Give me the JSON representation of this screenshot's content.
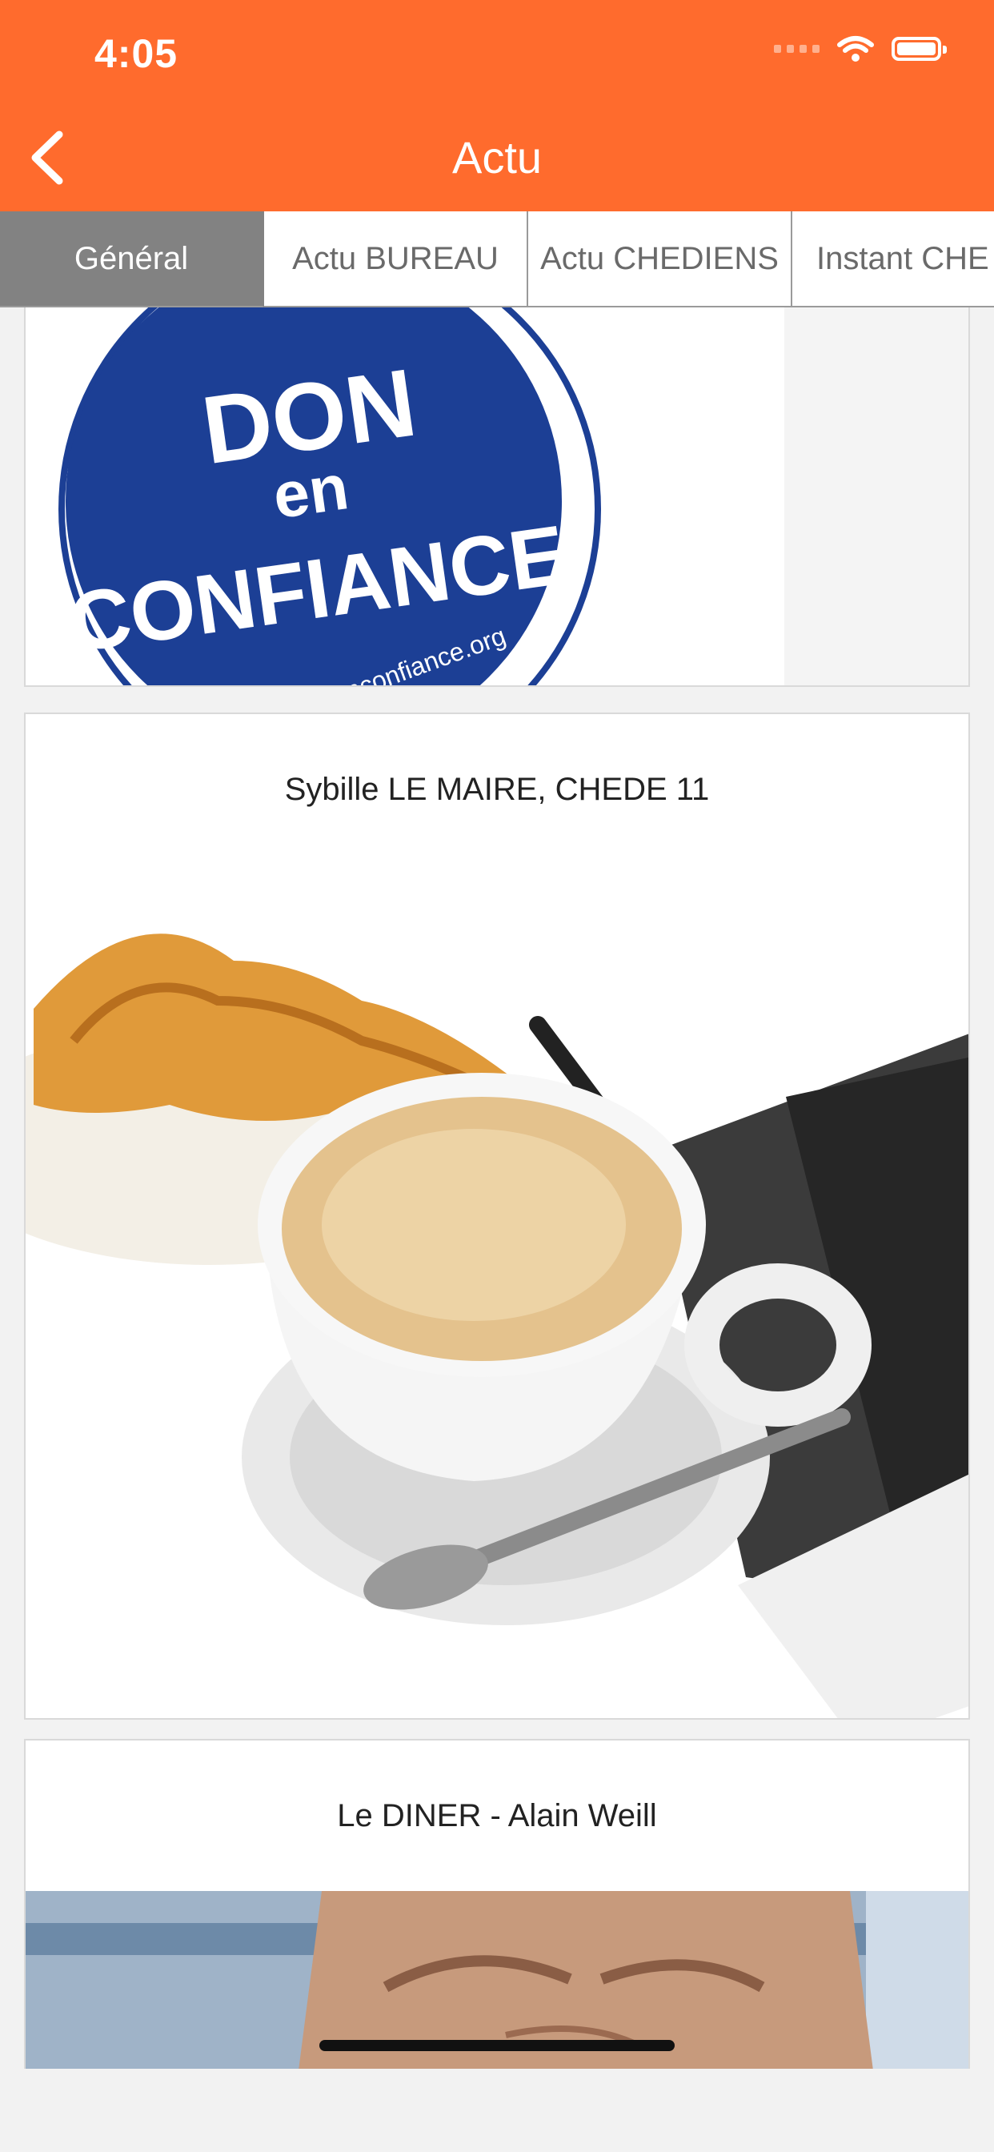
{
  "status_bar": {
    "time": "4:05"
  },
  "header": {
    "title": "Actu",
    "back_icon": "chevron-left-icon"
  },
  "tabs": [
    {
      "label": "Général",
      "active": true
    },
    {
      "label": "Actu BUREAU",
      "active": false
    },
    {
      "label": "Actu CHEDIENS",
      "active": false
    },
    {
      "label": "Instant CHE",
      "active": false
    }
  ],
  "feed": {
    "cards": [
      {
        "logo": {
          "line1": "DON",
          "line2": "en",
          "line3": "CONFIANCE",
          "site": "donenconfiance.org"
        }
      },
      {
        "title": "Sybille LE MAIRE, CHEDE 11",
        "image": "croissant-coffee-notebook"
      },
      {
        "title": "Le DINER - Alain Weill",
        "image": "portrait"
      }
    ]
  },
  "colors": {
    "accent": "#ff6b2d",
    "tab_active": "#828282"
  }
}
